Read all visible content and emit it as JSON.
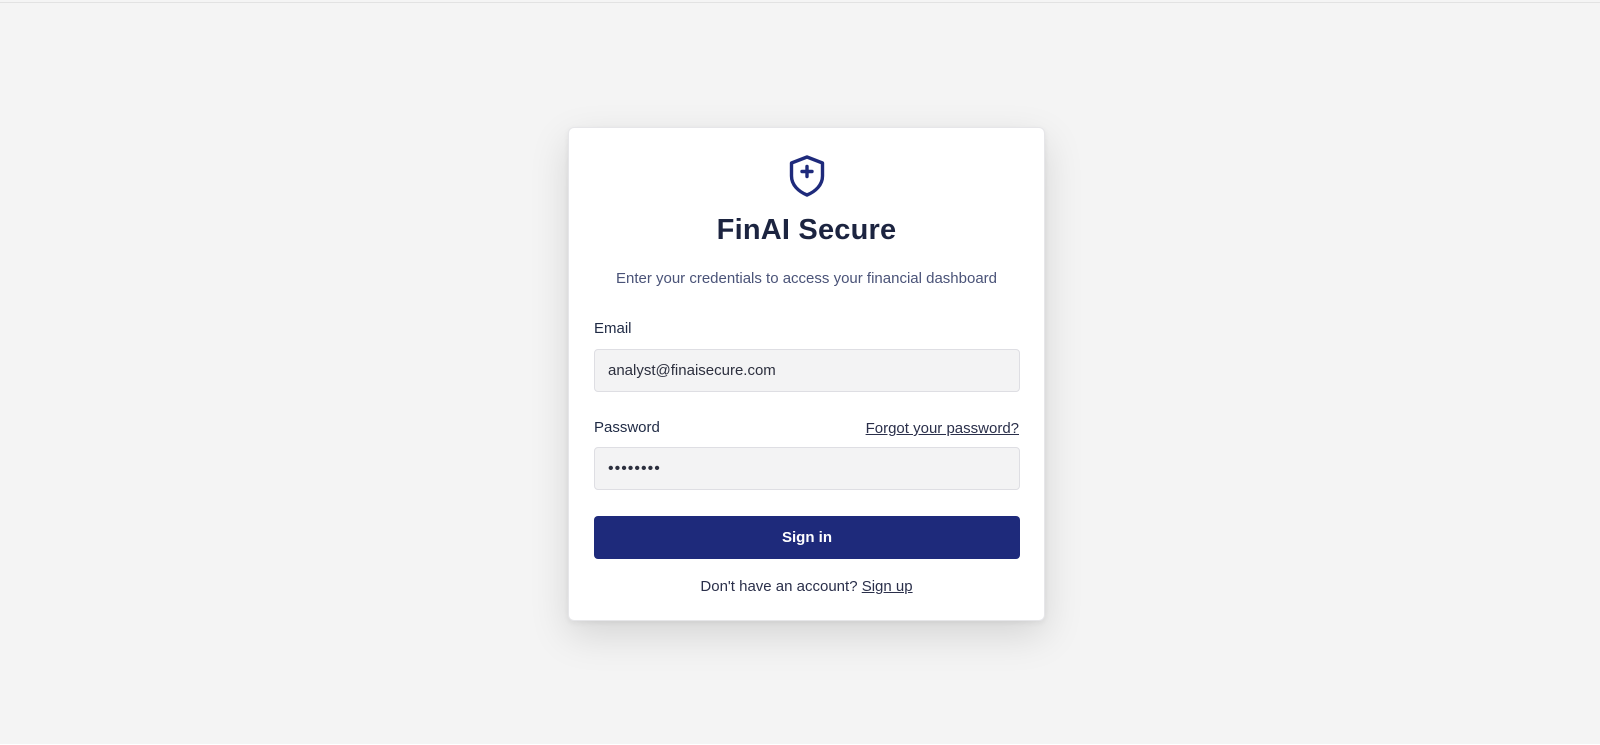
{
  "app": {
    "title": "FinAI Secure",
    "subtitle": "Enter your credentials to access your financial dashboard",
    "logo_icon": "shield-plus-icon",
    "accent_color": "#1e2a7b"
  },
  "form": {
    "email_label": "Email",
    "email_value": "analyst@finaisecure.com",
    "password_label": "Password",
    "password_value": "••••••••",
    "forgot_password_label": "Forgot your password?",
    "submit_label": "Sign in"
  },
  "footer": {
    "prompt": "Don't have an account?",
    "signup_label": "Sign up"
  }
}
